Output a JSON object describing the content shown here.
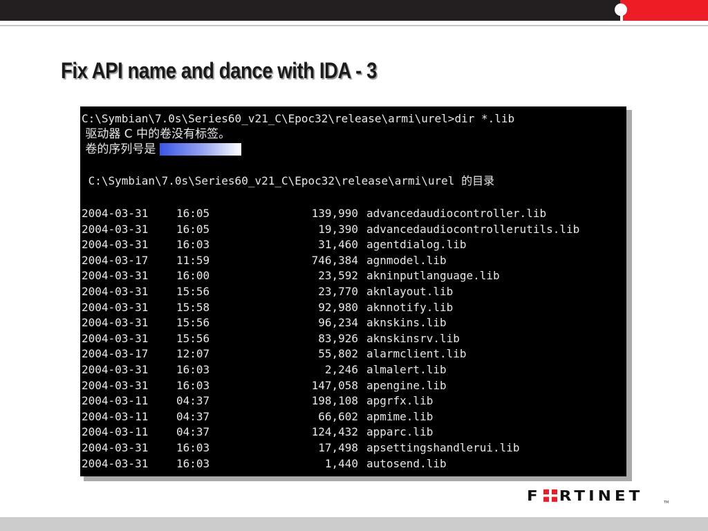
{
  "slide": {
    "title": "Fix API name and dance with IDA - 3"
  },
  "console": {
    "command_line": "C:\\Symbian\\7.0s\\Series60_v21_C\\Epoc32\\release\\armi\\urel>dir *.lib",
    "volume_line": " 驱动器 C 中的卷没有标签。",
    "serial_label": " 卷的序列号是",
    "directory_line": " C:\\Symbian\\7.0s\\Series60_v21_C\\Epoc32\\release\\armi\\urel 的目录",
    "files": [
      {
        "date": "2004-03-31",
        "time": "16:05",
        "size": "139,990",
        "name": "advancedaudiocontroller.lib"
      },
      {
        "date": "2004-03-31",
        "time": "16:05",
        "size": "19,390",
        "name": "advancedaudiocontrollerutils.lib"
      },
      {
        "date": "2004-03-31",
        "time": "16:03",
        "size": "31,460",
        "name": "agentdialog.lib"
      },
      {
        "date": "2004-03-17",
        "time": "11:59",
        "size": "746,384",
        "name": "agnmodel.lib"
      },
      {
        "date": "2004-03-31",
        "time": "16:00",
        "size": "23,592",
        "name": "akninputlanguage.lib"
      },
      {
        "date": "2004-03-31",
        "time": "15:56",
        "size": "23,770",
        "name": "aknlayout.lib"
      },
      {
        "date": "2004-03-31",
        "time": "15:58",
        "size": "92,980",
        "name": "aknnotify.lib"
      },
      {
        "date": "2004-03-31",
        "time": "15:56",
        "size": "96,234",
        "name": "aknskins.lib"
      },
      {
        "date": "2004-03-31",
        "time": "15:56",
        "size": "83,926",
        "name": "aknskinsrv.lib"
      },
      {
        "date": "2004-03-17",
        "time": "12:07",
        "size": "55,802",
        "name": "alarmclient.lib"
      },
      {
        "date": "2004-03-31",
        "time": "16:03",
        "size": "2,246",
        "name": "almalert.lib"
      },
      {
        "date": "2004-03-31",
        "time": "16:03",
        "size": "147,058",
        "name": "apengine.lib"
      },
      {
        "date": "2004-03-11",
        "time": "04:37",
        "size": "198,108",
        "name": "apgrfx.lib"
      },
      {
        "date": "2004-03-11",
        "time": "04:37",
        "size": "66,602",
        "name": "apmime.lib"
      },
      {
        "date": "2004-03-11",
        "time": "04:37",
        "size": "124,432",
        "name": "apparc.lib"
      },
      {
        "date": "2004-03-31",
        "time": "16:03",
        "size": "17,498",
        "name": "apsettingshandlerui.lib"
      },
      {
        "date": "2004-03-31",
        "time": "16:03",
        "size": "1,440",
        "name": "autosend.lib"
      }
    ]
  },
  "branding": {
    "logo_text": "FORTINET",
    "logo_prefix": "F",
    "logo_suffix": "RTINET",
    "trademark": "TM",
    "accent_color": "#ee1c25",
    "dark_color": "#231f20"
  }
}
